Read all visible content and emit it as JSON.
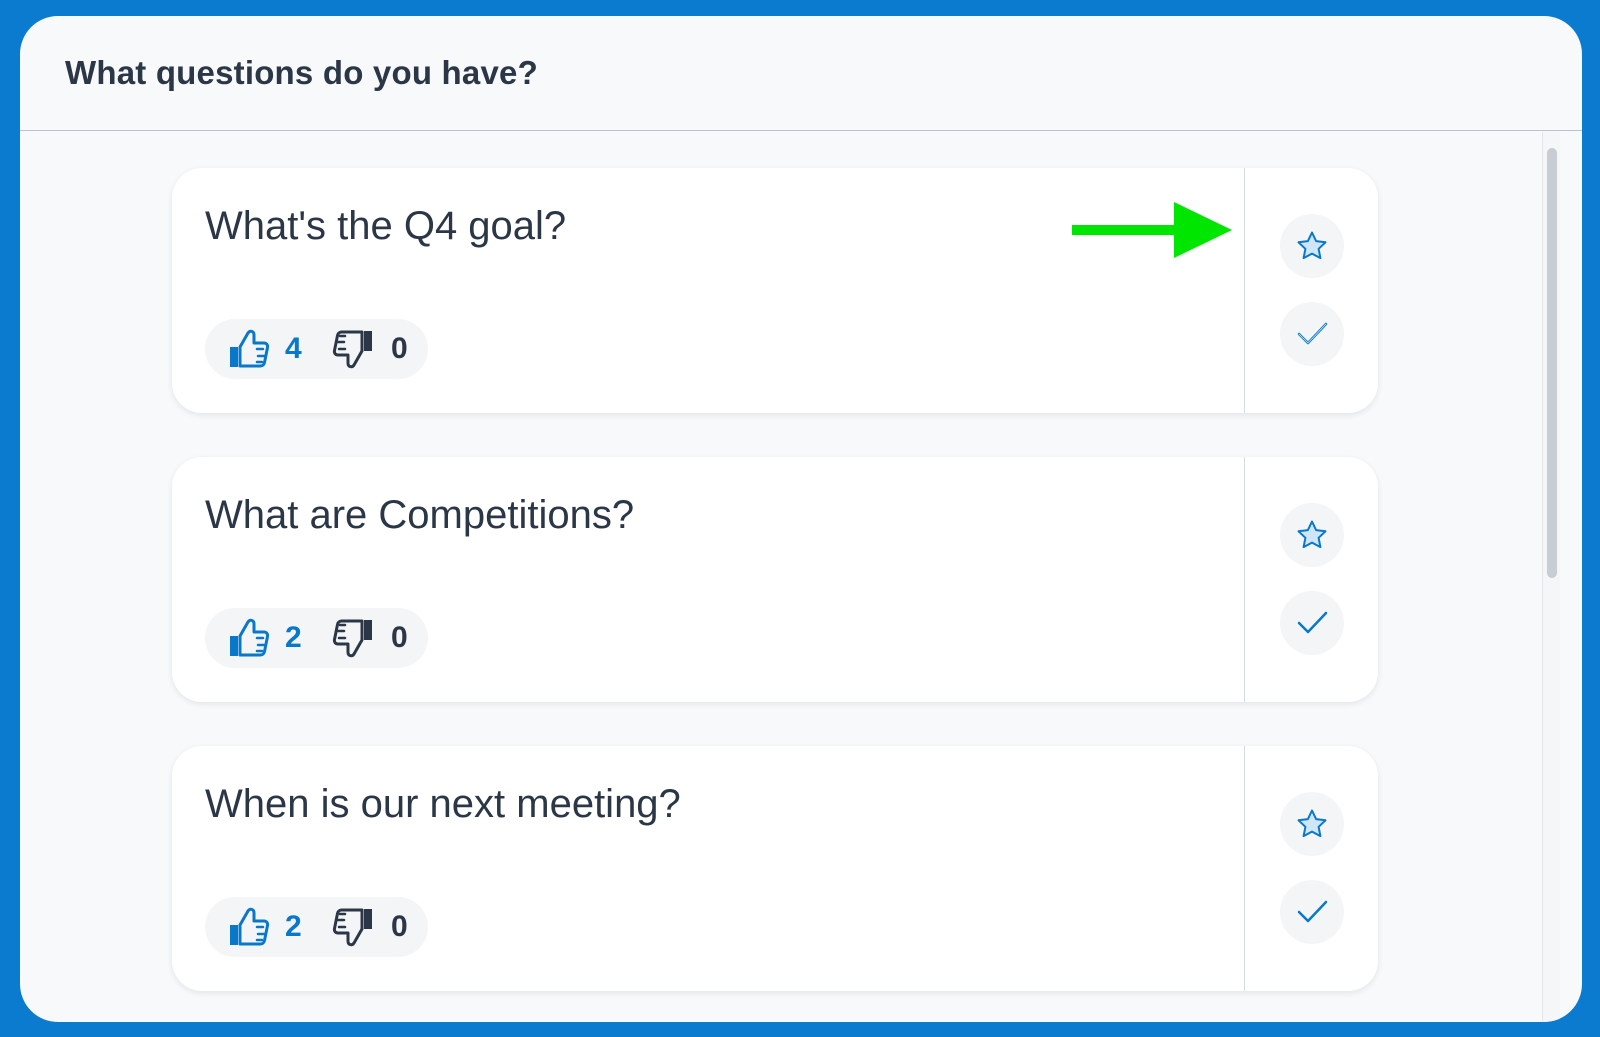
{
  "header": {
    "title": "What questions do you have?"
  },
  "colors": {
    "frame": "#0a7bcf",
    "accent": "#0a78c8",
    "text": "#2b3747",
    "annotation_arrow": "#00e600"
  },
  "questions": [
    {
      "text": "What's the Q4 goal?",
      "upvotes": "4",
      "downvotes": "0"
    },
    {
      "text": "What are Competitions?",
      "upvotes": "2",
      "downvotes": "0"
    },
    {
      "text": "When is our next meeting?",
      "upvotes": "2",
      "downvotes": "0"
    }
  ],
  "icons": {
    "upvote": "thumbs-up-icon",
    "downvote": "thumbs-down-icon",
    "highlight": "star-icon",
    "mark_answered": "check-icon",
    "annotation": "arrow-right-icon"
  }
}
